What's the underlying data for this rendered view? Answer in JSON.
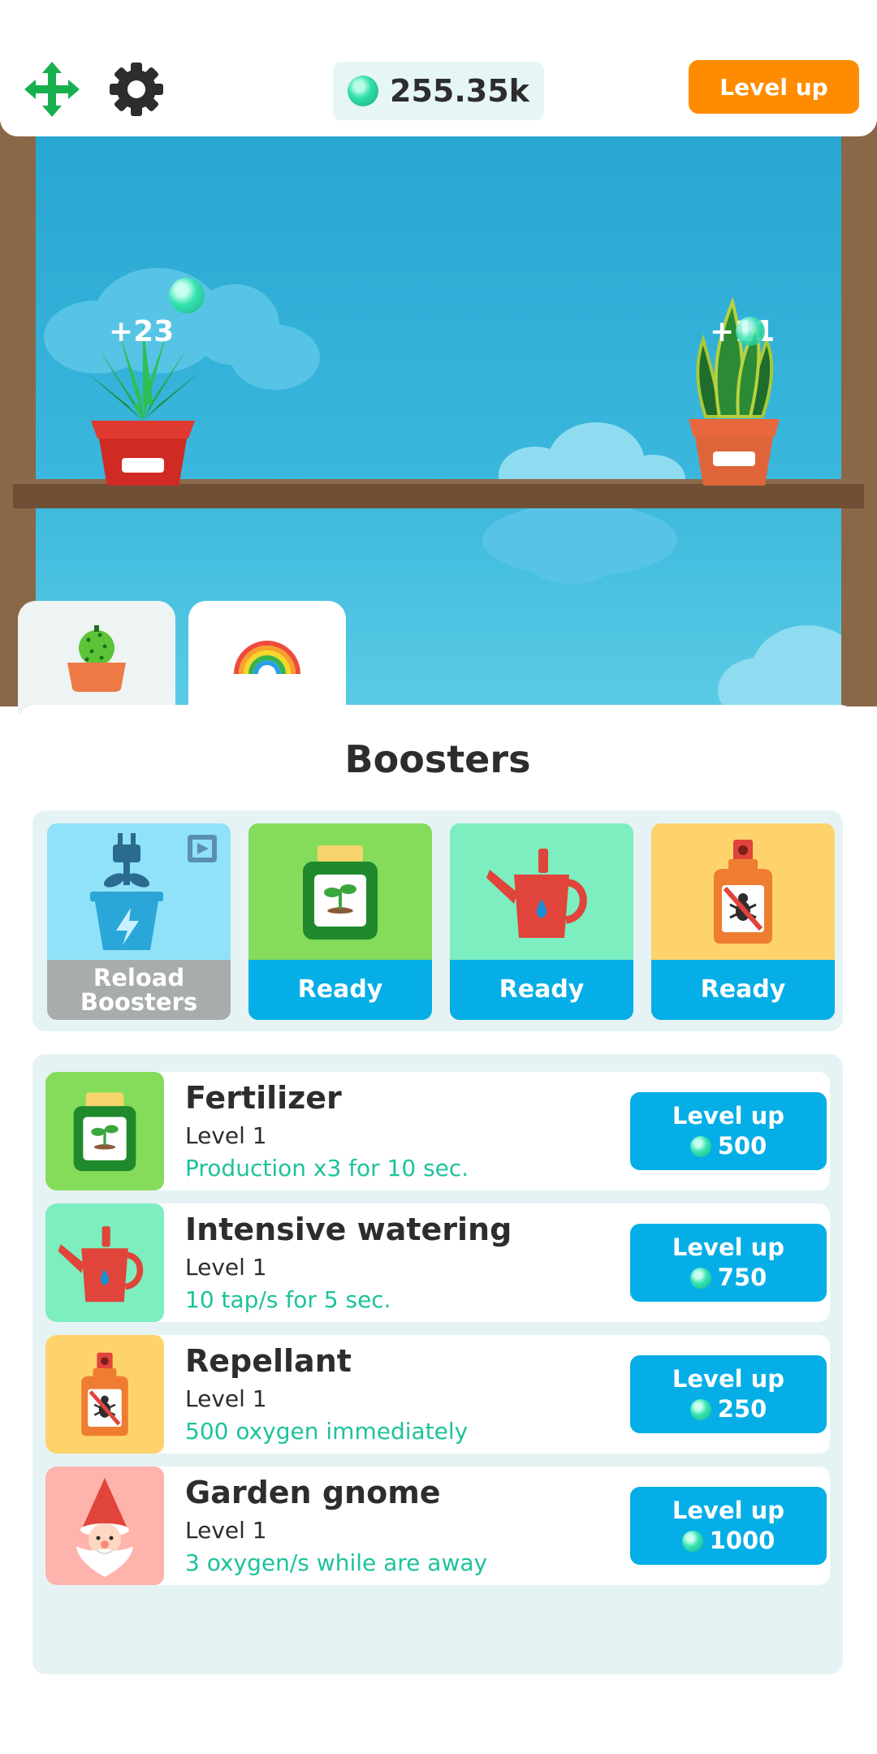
{
  "topbar": {
    "oxygen_value": "255.35k",
    "level_up_label": "Level up",
    "icons": [
      "move-icon",
      "gear-icon",
      "oxygen-icon"
    ]
  },
  "scene": {
    "plants": [
      {
        "name": "aloe-plant",
        "gain": "+23",
        "pot_color": "#d9302c"
      },
      {
        "name": "snake-plant",
        "gain": "+11",
        "pot_color": "#e0643a"
      }
    ]
  },
  "tabs": [
    {
      "name": "plants",
      "icon": "cactus-icon",
      "active": false
    },
    {
      "name": "boosters",
      "icon": "rainbow-icon",
      "active": true
    }
  ],
  "panel": {
    "title": "Boosters",
    "boosters": [
      {
        "icon": "plug-pot-icon",
        "label": "Reload Boosters",
        "bg": "#8fe2f8"
      },
      {
        "icon": "fertilizer-icon",
        "label": "Ready",
        "bg": "#84dc5a"
      },
      {
        "icon": "watering-can-icon",
        "label": "Ready",
        "bg": "#7deebf"
      },
      {
        "icon": "repellant-icon",
        "label": "Ready",
        "bg": "#ffd36b"
      }
    ],
    "upgrades": [
      {
        "name": "Fertilizer",
        "level": "Level 1",
        "desc": "Production x3 for 10 sec.",
        "button": "Level up",
        "cost": "500",
        "icon": "fertilizer-icon",
        "bg": "#84dc5a"
      },
      {
        "name": "Intensive watering",
        "level": "Level 1",
        "desc": "10 tap/s for 5 sec.",
        "button": "Level up",
        "cost": "750",
        "icon": "watering-can-icon",
        "bg": "#7deebf"
      },
      {
        "name": "Repellant",
        "level": "Level 1",
        "desc": "500 oxygen immediately",
        "button": "Level up",
        "cost": "250",
        "icon": "repellant-icon",
        "bg": "#ffd36b"
      },
      {
        "name": "Garden gnome",
        "level": "Level 1",
        "desc": "3 oxygen/s while are away",
        "button": "Level up",
        "cost": "1000",
        "icon": "gnome-icon",
        "bg": "#ffb3ad"
      }
    ]
  },
  "colors": {
    "accent_orange": "#ff8c00",
    "button_blue": "#05aee6",
    "desc_green": "#1ec29c",
    "sky": "#27a6d2"
  }
}
